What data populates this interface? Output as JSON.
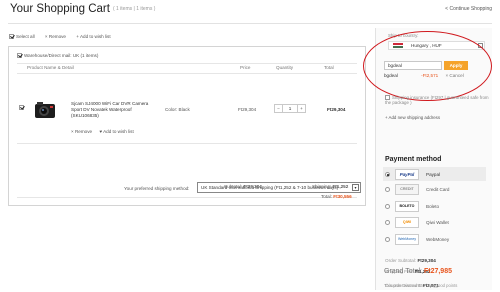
{
  "header": {
    "title": "Your Shopping Cart",
    "item_count": "( 1 items | 1 items )",
    "continue_label": "< Continue Shopping"
  },
  "toolbar": {
    "select_all": "Select all",
    "remove": "× Remove",
    "add_wish": "+ Add to wish list"
  },
  "warehouse": {
    "label": "Warehouse/Direct mail: UK (1 items)"
  },
  "columns": {
    "product": "Product Name & Detail",
    "price": "Price",
    "quantity": "Quantity",
    "total": "Total"
  },
  "product": {
    "name": "Sjcam SJ4000 WiFi Car DVR Camera Sport DV Novatek Waterproof (SKU106835)",
    "color": "Color: Black",
    "price": "Ft29,304",
    "qty": "1",
    "minus": "−",
    "plus": "+",
    "total": "Ft29,304",
    "remove": "× Remove",
    "add_wish": "♥ Add to wish list"
  },
  "shipping": {
    "label": "Your preferred shipping method:",
    "selected": "UK Standard International Shipping (Ft1,252 & 7-10 business days)",
    "subtotal_label": "Subtotal:",
    "subtotal": "Ft29,304",
    "shipping_label": "Shipping:",
    "shipping": "Ft1,252",
    "total_label": "Total:",
    "total": "Ft30,556"
  },
  "sidebar": {
    "ship_to_label": "Ship to country:",
    "country": "Hungary , HUF",
    "coupon_value": "bgdeal",
    "apply": "Apply",
    "coupon_name": "bgdeal",
    "coupon_amount": "-Ft2,571",
    "cancel": "× Cancel",
    "insurance_label": "Shipping insurance (Ft297 | guaranteed safe from the package )",
    "add_address": "+ Add new shipping address",
    "payment_title": "Payment method",
    "payment_methods": [
      {
        "logo": "PayPal",
        "name": "Paypal"
      },
      {
        "logo": "CREDIT CARD",
        "name": "Credit Card"
      },
      {
        "logo": "BOLETO",
        "name": "Boleto"
      },
      {
        "logo": "QIWI",
        "name": "Qiwi Wallet"
      },
      {
        "logo": "WebMoney",
        "name": "WebMoney"
      }
    ],
    "order_subtotal_label": "Order Subtotal:",
    "order_subtotal": "Ft29,304",
    "shipping_fee_label": "Shipping Fee:",
    "shipping_fee": "Ft1,252",
    "coupon_discount_label": "Coupon Discount:",
    "coupon_discount": "Ft2,571",
    "grand_total_label": "Grand Total:",
    "grand_total": "Ft27,985",
    "points_note": "This order earned 553 banggood points"
  },
  "colors": {
    "accent": "#e8541c",
    "apply": "#f5a32a",
    "highlight_oval": "#d0191e"
  },
  "icons": [
    "checkbox-icon",
    "product-thumbnail",
    "dropdown-arrow-icon",
    "hungary-flag-icon",
    "radio-icon",
    "paypal-logo-icon",
    "credit-card-logo-icon",
    "boleto-logo-icon",
    "qiwi-logo-icon",
    "webmoney-logo-icon"
  ]
}
